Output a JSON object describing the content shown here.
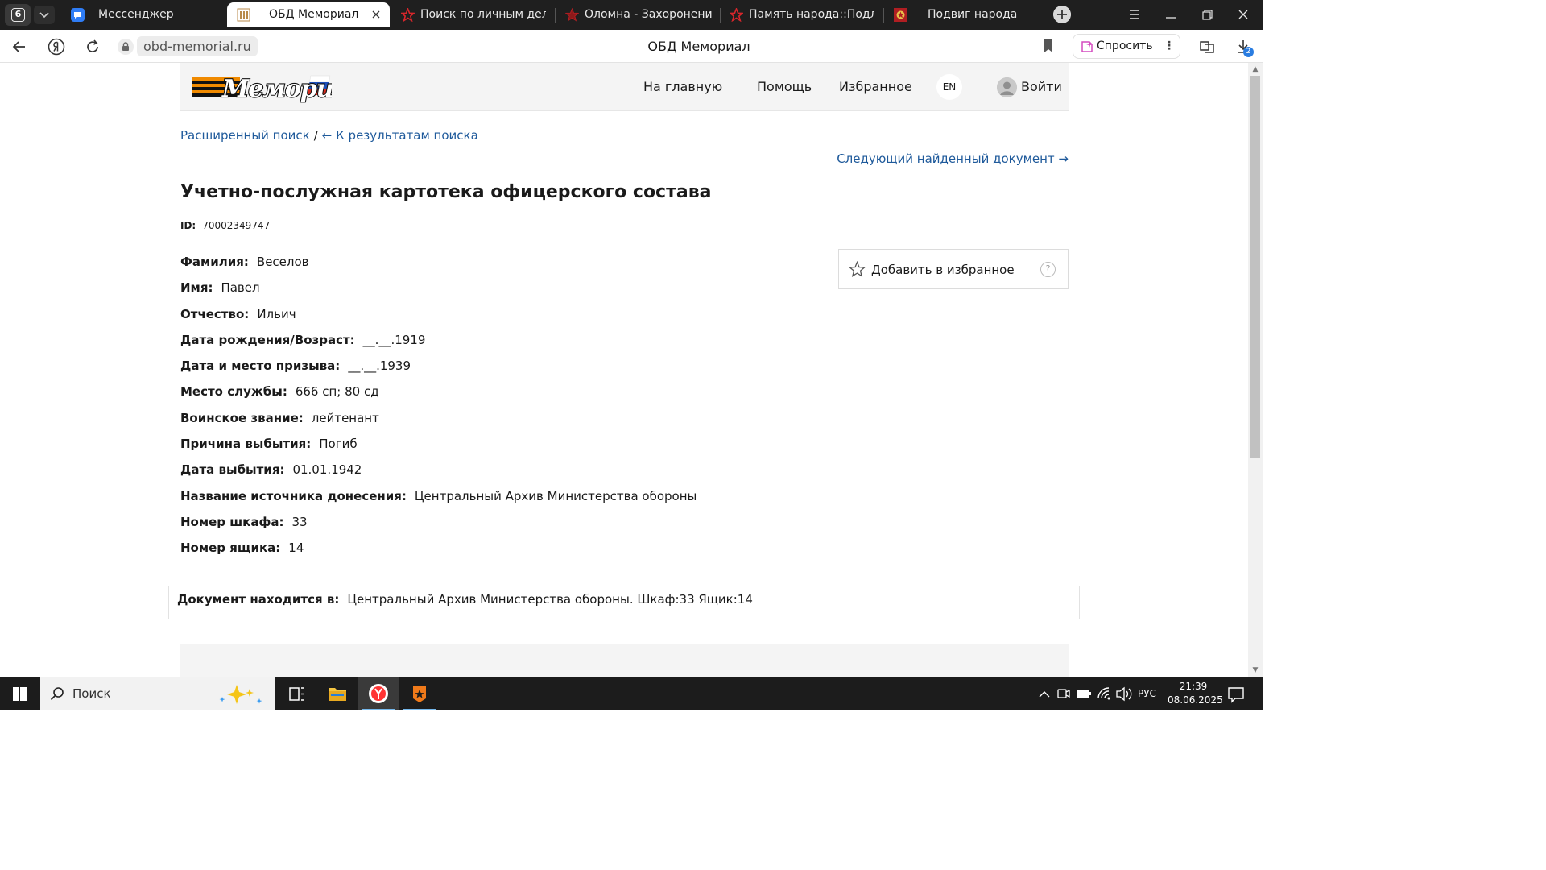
{
  "browser": {
    "tab_count": "6",
    "tabs": [
      {
        "label": "Мессенджер",
        "active": false
      },
      {
        "label": "ОБД Мемориал",
        "active": true
      },
      {
        "label": "Поиск по личным делам ВС",
        "active": false
      },
      {
        "label": "Оломна - Захоронение ВВ",
        "active": false
      },
      {
        "label": "Память народа::Подлинные",
        "active": false
      },
      {
        "label": "Подвиг народа",
        "active": false
      }
    ],
    "url_domain": "obd-memorial.ru",
    "page_title": "ОБД Мемориал",
    "ask_label": "Спросить",
    "downloads_badge": "2",
    "colors": {
      "tabstrip": "#1f1f1f",
      "accent": "#2a7de1"
    }
  },
  "site": {
    "nav": {
      "home": "На главную",
      "help": "Помощь",
      "favorites": "Избранное",
      "lang": "EN",
      "login": "Войти"
    },
    "breadcrumb": {
      "advanced_search": "Расширенный поиск",
      "separator": "/",
      "back_to_results": "← К результатам поиска"
    },
    "next_document": "Следующий найденный документ →",
    "document": {
      "title": "Учетно-послужная картотека офицерского состава",
      "id_label": "ID:",
      "id_value": "70002349747",
      "fields": [
        {
          "label": "Фамилия:",
          "value": "Веселов"
        },
        {
          "label": "Имя:",
          "value": "Павел"
        },
        {
          "label": "Отчество:",
          "value": "Ильич"
        },
        {
          "label": "Дата рождения/Возраст:",
          "value": "__.__.1919"
        },
        {
          "label": "Дата и место призыва:",
          "value": "__.__.1939"
        },
        {
          "label": "Место службы:",
          "value": "666 сп; 80 сд"
        },
        {
          "label": "Воинское звание:",
          "value": "лейтенант"
        },
        {
          "label": "Причина выбытия:",
          "value": "Погиб"
        },
        {
          "label": "Дата выбытия:",
          "value": "01.01.1942"
        },
        {
          "label": "Название источника донесения:",
          "value": "Центральный Архив Министерства обороны"
        },
        {
          "label": "Номер шкафа:",
          "value": "33"
        },
        {
          "label": "Номер ящика:",
          "value": "14"
        }
      ],
      "add_to_favorites": "Добавить в избранное",
      "help_glyph": "?",
      "location_label": "Документ находится в:",
      "location_value": "Центральный Архив Министерства обороны. Шкаф:33 Ящик:14"
    },
    "colors": {
      "link": "#1f5a9b",
      "header_bg": "#f4f4f4"
    }
  },
  "taskbar": {
    "search_placeholder": "Поиск",
    "language": "РУС",
    "time": "21:39",
    "date": "08.06.2025",
    "icons": [
      "windows-start-icon",
      "search-icon",
      "task-view-icon",
      "file-explorer-icon",
      "yandex-browser-icon",
      "memorial-app-icon",
      "chevron-up-icon",
      "camera-icon",
      "battery-icon",
      "wifi-icon",
      "speaker-icon",
      "notifications-icon"
    ]
  }
}
